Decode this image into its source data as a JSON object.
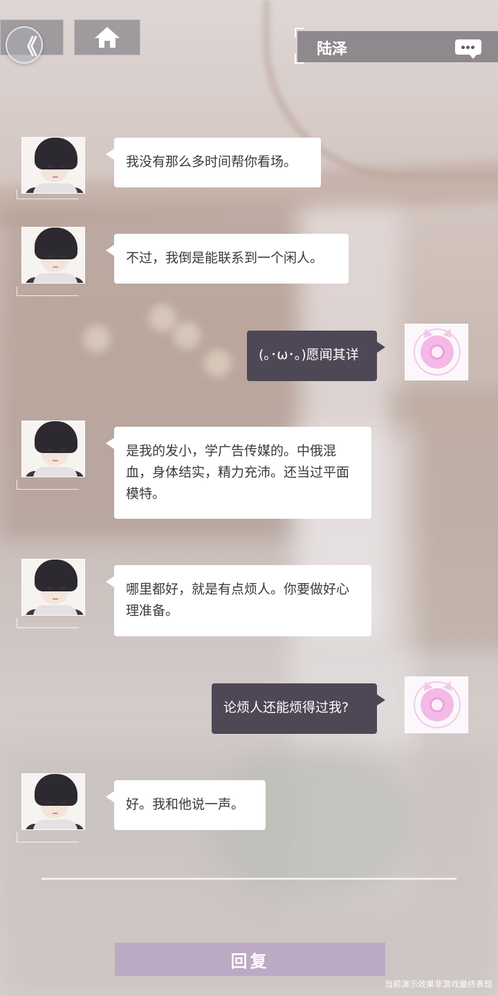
{
  "header": {
    "back_glyph": "《",
    "home_icon": "home-icon",
    "contact_name": "陆泽",
    "more_icon": "chat-bubble-icon"
  },
  "messages": [
    {
      "side": "in",
      "text": "我没有那么多时间帮你看场。"
    },
    {
      "side": "in",
      "text": "不过，我倒是能联系到一个闲人。"
    },
    {
      "side": "out",
      "text": "(｡･ω･｡)愿闻其详"
    },
    {
      "side": "in",
      "text": "是我的发小，学广告传媒的。中俄混血，身体结实，精力充沛。还当过平面模特。"
    },
    {
      "side": "in",
      "text": "哪里都好，就是有点烦人。你要做好心理准备。"
    },
    {
      "side": "out",
      "text": "论烦人还能烦得过我?"
    },
    {
      "side": "in",
      "text": "好。我和他说一声。"
    }
  ],
  "footer": {
    "reply_label": "回复",
    "disclaimer": "当前演示效果非游戏最终表现"
  },
  "colors": {
    "incoming_bubble": "#ffffff",
    "outgoing_bubble": "#4d4756",
    "reply_button": "#b6a0c4"
  }
}
